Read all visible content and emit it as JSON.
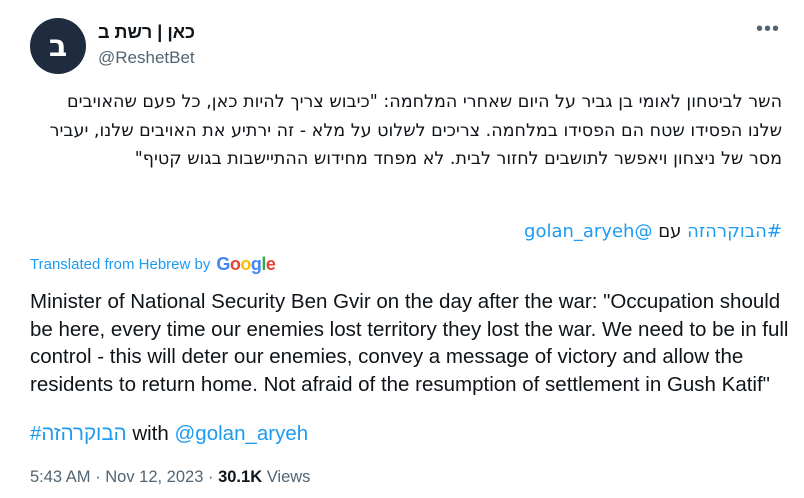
{
  "account": {
    "display_name": "כאן | רשת ב",
    "handle": "@ReshetBet",
    "avatar_letter": "ב",
    "avatar_color": "#1f2c3f"
  },
  "more_icon": "more-horizontal-icon",
  "tweet": {
    "hebrew_text": "השר לביטחון לאומי בן גביר על היום שאחרי המלחמה: \"כיבוש צריך להיות כאן, כל פעם שהאויבים שלנו הפסידו שטח הם הפסידו במלחמה. צריכים לשלוט על מלא - זה ירתיע את האויבים שלנו, יעביר מסר של ניצחון ויאפשר לתושבים לחזור לבית. לא מפחד מחידוש ההתיישבות בגוש קטיף\"",
    "hashtag": "#הבוקרהזה",
    "with_he": "עם",
    "mention": "@golan_aryeh",
    "translated_label": "Translated from Hebrew by",
    "google_letters": [
      "G",
      "o",
      "o",
      "g",
      "l",
      "e"
    ],
    "english_text": "Minister of National Security Ben Gvir on the day after the war: \"Occupation should be here, every time our enemies lost territory they lost the war. We need to be in full control - this will deter our enemies, convey a message of victory and allow the residents to return home. Not afraid of the resumption of settlement in Gush Katif\"",
    "with_en": "with"
  },
  "meta": {
    "time": "5:43 AM",
    "sep1": "·",
    "date": "Nov 12, 2023",
    "sep2": "·",
    "views_count": "30.1K",
    "views_label": "Views"
  },
  "colors": {
    "link": "#1d9bf0",
    "text": "#0f1419",
    "secondary": "#536471"
  }
}
